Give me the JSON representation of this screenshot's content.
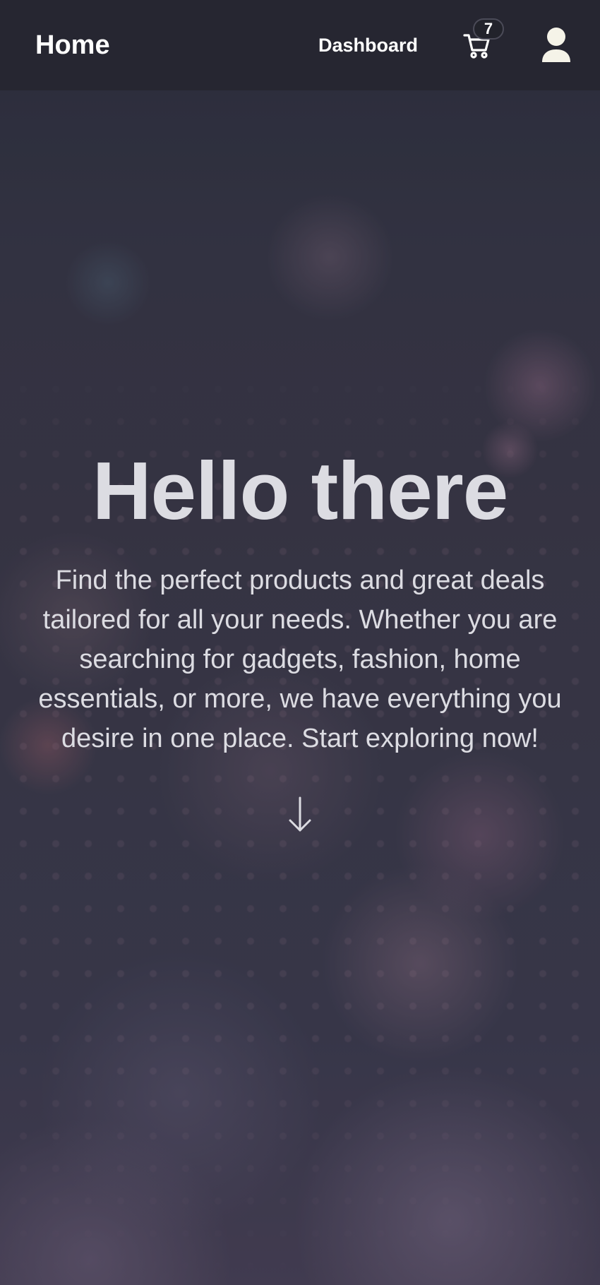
{
  "navbar": {
    "brand": "Home",
    "dashboard_label": "Dashboard",
    "cart_count": "7"
  },
  "hero": {
    "title": "Hello there",
    "text": "Find the perfect products and great deals tailored for all your needs. Whether you are searching for gadgets, fashion, home essentials, or more, we have everything you desire in one place. Start exploring now!"
  },
  "icons": {
    "cart": "shopping-cart-icon",
    "user": "user-icon",
    "scroll": "arrow-down-icon"
  },
  "colors": {
    "navbar_bg": "#26262f",
    "text_light": "#dcdce2",
    "white": "#ffffff",
    "badge_bg": "#22232b"
  }
}
